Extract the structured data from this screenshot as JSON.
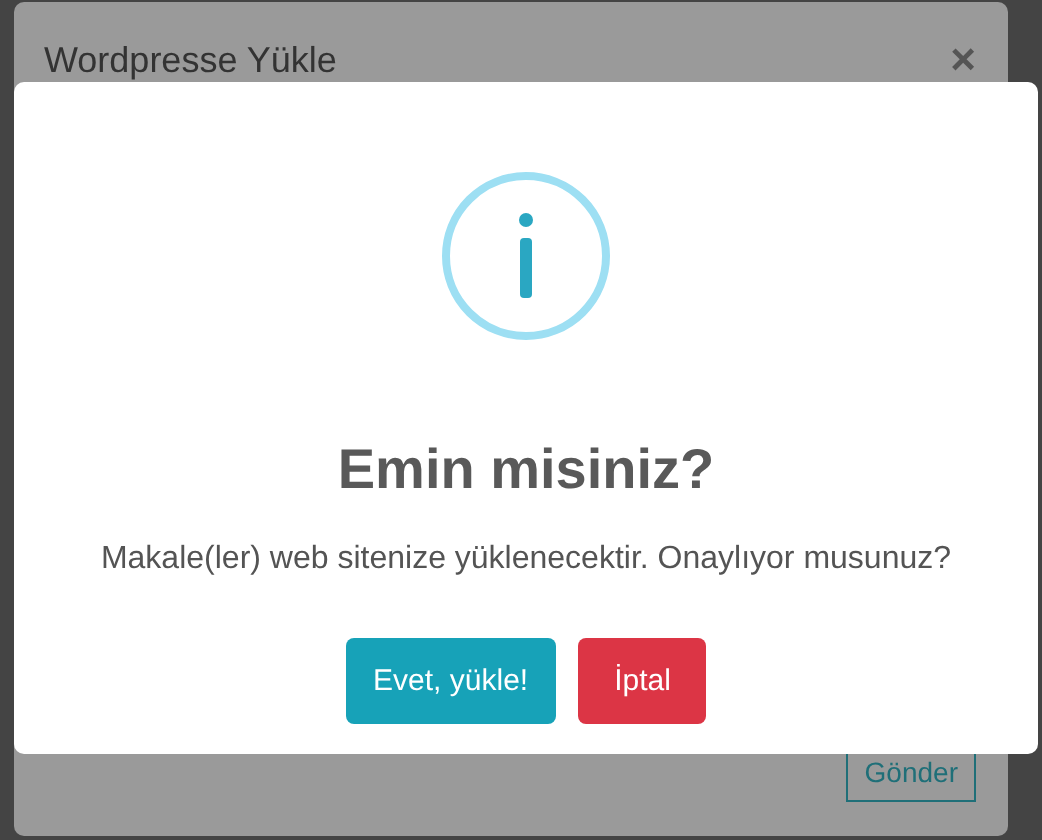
{
  "background_modal": {
    "title": "Wordpresse Yükle",
    "close": "×",
    "submit_button": "Gönder"
  },
  "alert": {
    "title": "Emin misiniz?",
    "message": "Makale(ler) web sitenize yüklenecektir. Onaylıyor musunuz?",
    "buttons": [
      {
        "label": "Evet, yükle!",
        "kind": "confirm"
      },
      {
        "label": "İptal",
        "kind": "cancel"
      }
    ]
  }
}
